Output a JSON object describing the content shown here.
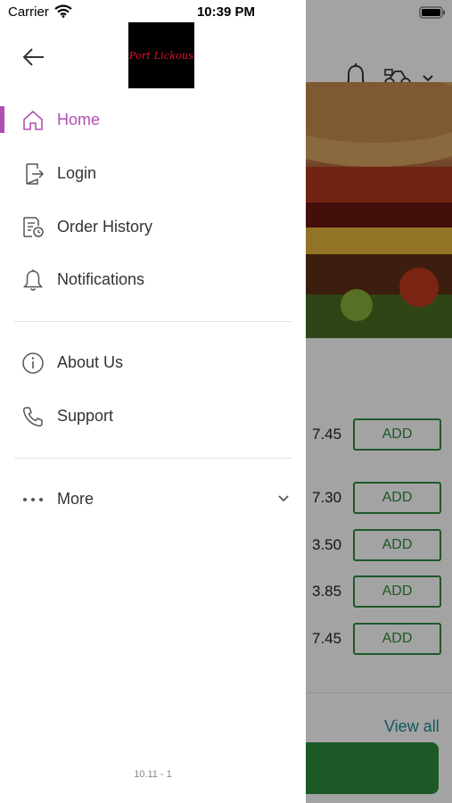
{
  "status_bar": {
    "carrier": "Carrier",
    "time": "10:39 PM"
  },
  "drawer": {
    "logo_text": "Port Lickous",
    "nav_items": [
      {
        "label": "Home",
        "icon": "home-icon",
        "active": true
      },
      {
        "label": "Login",
        "icon": "login-icon",
        "active": false
      },
      {
        "label": "Order History",
        "icon": "order-history-icon",
        "active": false
      },
      {
        "label": "Notifications",
        "icon": "bell-icon",
        "active": false
      },
      {
        "label": "About Us",
        "icon": "info-icon",
        "active": false
      },
      {
        "label": "Support",
        "icon": "phone-icon",
        "active": false
      },
      {
        "label": "More",
        "icon": "more-dots-icon",
        "active": false
      }
    ],
    "version": "10.11 - 1"
  },
  "background": {
    "items": [
      {
        "price": "7.45",
        "button": "ADD"
      },
      {
        "price": "7.30",
        "button": "ADD"
      },
      {
        "price": "3.50",
        "button": "ADD"
      },
      {
        "price": "3.85",
        "button": "ADD"
      },
      {
        "price": "7.45",
        "button": "ADD"
      }
    ],
    "view_all": "View all"
  },
  "colors": {
    "accent": "#b04fb3",
    "add_green": "#2e8b3d",
    "link": "#1a8a9a"
  }
}
